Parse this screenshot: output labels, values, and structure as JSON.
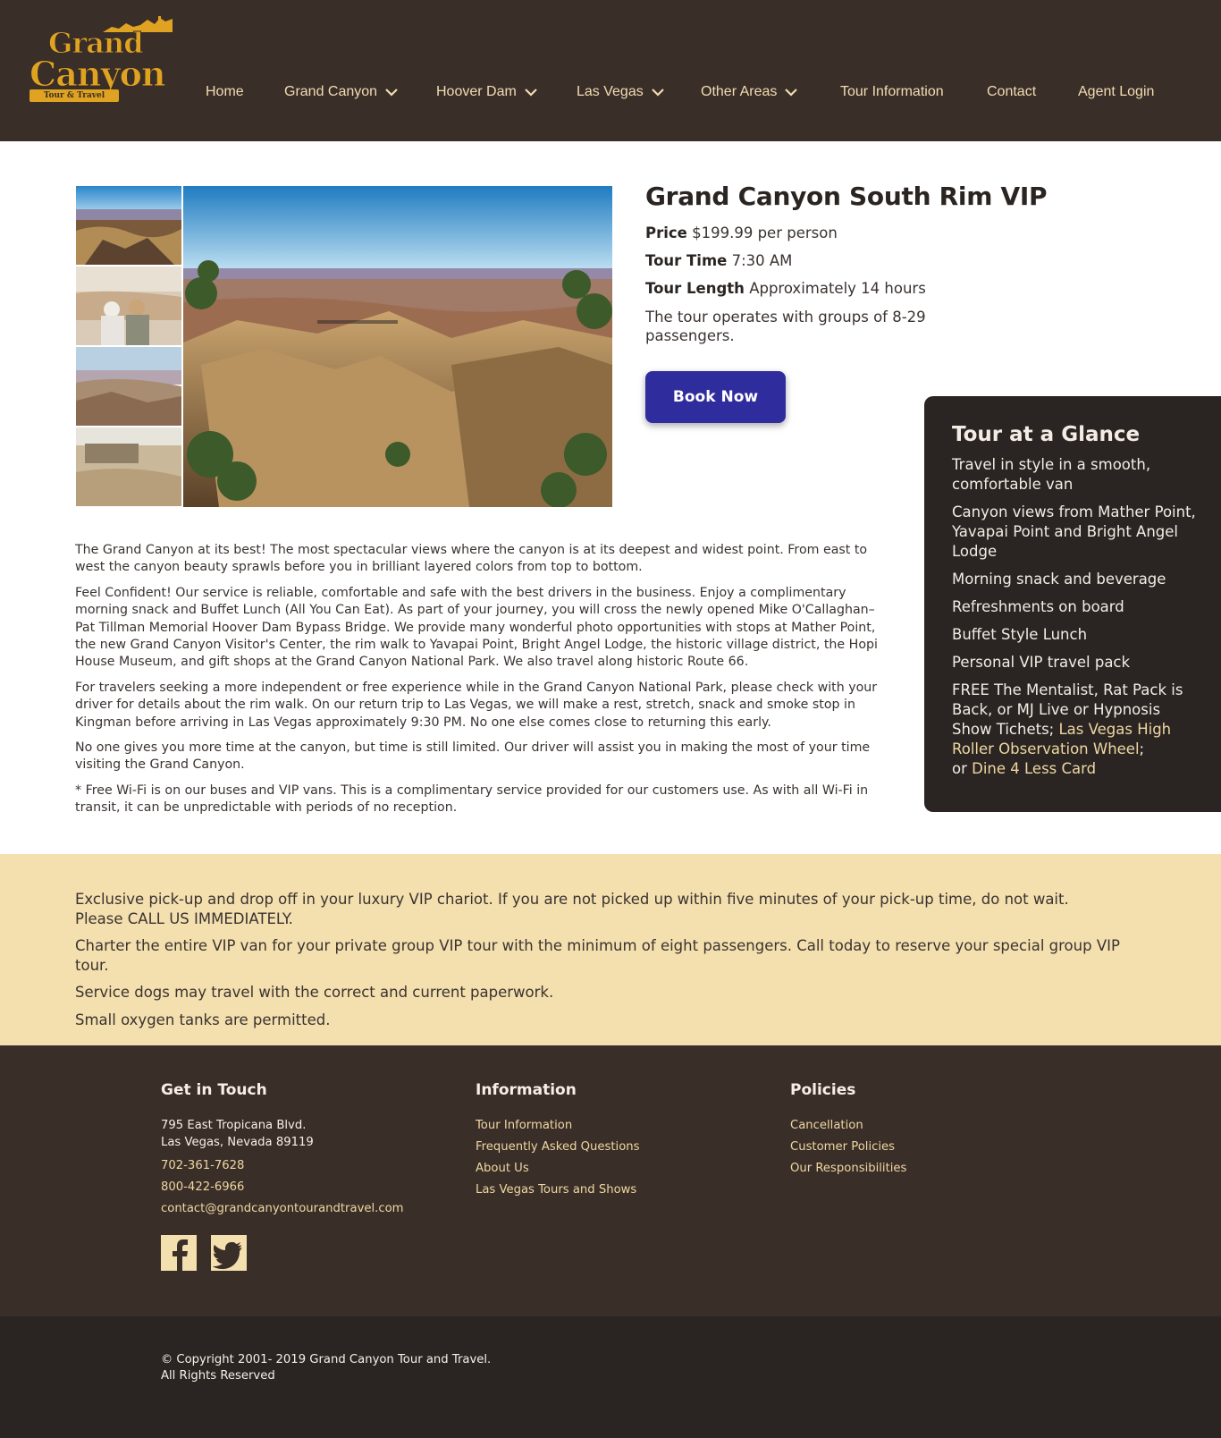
{
  "brand": {
    "logo_word_1": "Grand",
    "logo_word_2": "Canyon",
    "logo_tagline": "Tour & Travel"
  },
  "nav": {
    "items": [
      {
        "label": "Home"
      },
      {
        "label": "Grand Canyon"
      },
      {
        "label": "Hoover Dam"
      },
      {
        "label": "Las Vegas"
      },
      {
        "label": "Other Areas"
      },
      {
        "label": "Tour Information"
      },
      {
        "label": "Contact"
      },
      {
        "label": "Agent Login"
      }
    ]
  },
  "tour": {
    "title": "Grand Canyon South Rim VIP",
    "price_label": "Price",
    "price_value": "$199.99 per person",
    "time_label": "Tour Time",
    "time_value": "7:30 AM",
    "length_label": "Tour Length",
    "length_value": "Approximately 14 hours",
    "groups_text": "The tour operates with groups of 8-29 passengers.",
    "book_label": "Book Now"
  },
  "glance": {
    "title": "Tour at a Glance",
    "items": [
      "Travel in style in a smooth, comfortable van",
      "Canyon views from Mather Point, Yavapai Point and Bright Angel Lodge",
      "Morning snack and beverage",
      "Refreshments on board",
      "Buffet Style Lunch",
      "Personal VIP travel pack"
    ],
    "free_text": "FREE The Mentalist, Rat Pack is Back, or MJ Live or Hypnosis Show Tichets;",
    "free_link_1": "Las Vegas High Roller Observation Wheel",
    "free_sep": ";",
    "free_or": "or",
    "free_link_2": "Dine 4 Less Card"
  },
  "description": {
    "paragraphs": [
      "The Grand Canyon at its best! The most spectacular views where the canyon is at its deepest and widest point. From east to west the canyon beauty sprawls before you in brilliant layered colors from top to bottom.",
      "Feel Confident! Our service is reliable, comfortable and safe with the best drivers in the business. Enjoy a complimentary morning snack and Buffet Lunch (All You Can Eat). As part of your journey, you will cross the newly opened Mike O'Callaghan–Pat Tillman Memorial Hoover Dam Bypass Bridge. We provide many wonderful photo opportunities with stops at Mather Point, the new Grand Canyon Visitor's Center, the rim walk to Yavapai Point, Bright Angel Lodge, the historic village district, the Hopi House Museum, and gift shops at the Grand Canyon National Park. We also travel along historic Route 66.",
      "For travelers seeking a more independent or free experience while in the Grand Canyon National Park, please check with your driver for details about the rim walk. On our return trip to Las Vegas, we will make a rest, stretch, snack and smoke stop in Kingman before arriving in Las Vegas approximately 9:30 PM. No one else comes close to returning this early.",
      "No one gives you more time at the canyon, but time is still limited. Our driver will assist you in making the most of your time visiting the Grand Canyon.",
      "* Free Wi-Fi is on our buses and VIP vans. This is a complimentary service provided for our customers use. As with all Wi-Fi in transit, it can be unpredictable with periods of no reception."
    ]
  },
  "notice": {
    "line_1a": "Exclusive pick-up and drop off in your luxury VIP chariot. If you are not picked up within five minutes of your pick-up time, do not wait.",
    "line_1b": "Please CALL US IMMEDIATELY.",
    "line_2": "Charter the entire VIP van for your private group VIP tour with the minimum of eight passengers. Call today to reserve your special group VIP tour.",
    "line_3": "Service dogs may travel with the correct and current paperwork.",
    "line_4": "Small oxygen tanks are permitted."
  },
  "footer": {
    "contact": {
      "title": "Get in Touch",
      "address_1": "795 East Tropicana Blvd.",
      "address_2": "Las Vegas, Nevada 89119",
      "phone_1": "702-361-7628",
      "phone_2": "800-422-6966",
      "email": "contact@grandcanyontourandtravel.com"
    },
    "information": {
      "title": "Information",
      "links": [
        "Tour Information",
        "Frequently Asked Questions",
        "About Us",
        "Las Vegas Tours and Shows"
      ]
    },
    "policies": {
      "title": "Policies",
      "links": [
        "Cancellation",
        "Customer Policies",
        "Our Responsibilities"
      ]
    },
    "copyright_1": "© Copyright 2001- 2019 Grand Canyon Tour and Travel.",
    "copyright_2": "All Rights Reserved"
  },
  "colors": {
    "header_bg": "#3a2e29",
    "accent_gold": "#e0a321",
    "nav_text": "#f1dcb2",
    "book_button": "#2f2c9e",
    "glance_bg": "#2a2523",
    "notice_bg": "#f4dfae",
    "link_gold": "#efd7a1"
  }
}
